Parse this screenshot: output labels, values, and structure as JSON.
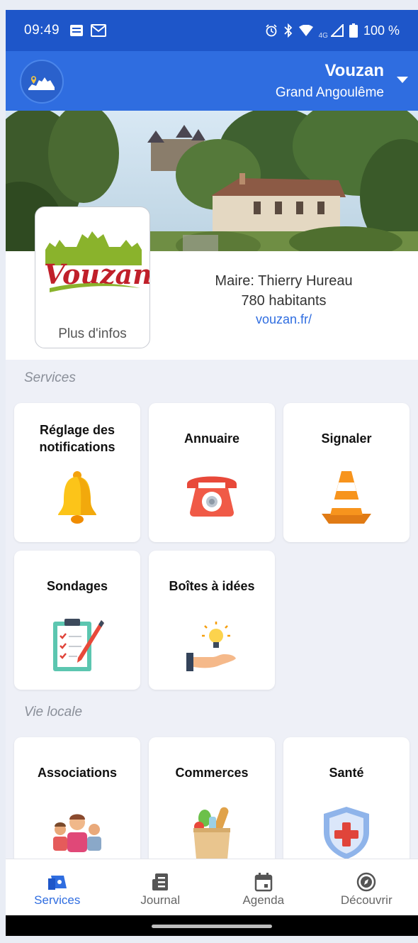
{
  "status_bar": {
    "time": "09:49",
    "network": "4G",
    "battery": "100 %"
  },
  "header": {
    "town": "Vouzan",
    "region": "Grand Angoulême"
  },
  "town_card": {
    "logo_text": "Vouzan",
    "more_label": "Plus d'infos"
  },
  "town_info": {
    "mayor": "Maire: Thierry Hureau",
    "population": "780 habitants",
    "website": "vouzan.fr/"
  },
  "sections": {
    "services": {
      "title": "Services",
      "items": [
        {
          "label": "Réglage des notifications",
          "icon": "bell-icon"
        },
        {
          "label": "Annuaire",
          "icon": "telephone-icon"
        },
        {
          "label": "Signaler",
          "icon": "traffic-cone-icon"
        },
        {
          "label": "Sondages",
          "icon": "clipboard-checklist-icon"
        },
        {
          "label": "Boîtes à idées",
          "icon": "lightbulb-hand-icon"
        }
      ]
    },
    "local_life": {
      "title": "Vie locale",
      "items": [
        {
          "label": "Associations",
          "icon": "people-group-icon"
        },
        {
          "label": "Commerces",
          "icon": "grocery-bag-icon"
        },
        {
          "label": "Santé",
          "icon": "medical-shield-icon"
        }
      ]
    }
  },
  "bottom_nav": [
    {
      "label": "Services",
      "icon": "services-icon",
      "active": true
    },
    {
      "label": "Journal",
      "icon": "newspaper-icon",
      "active": false
    },
    {
      "label": "Agenda",
      "icon": "calendar-icon",
      "active": false
    },
    {
      "label": "Découvrir",
      "icon": "compass-icon",
      "active": false
    }
  ],
  "colors": {
    "primary": "#2f6de0",
    "status_bar": "#1e56c9",
    "background": "#eef0f7"
  }
}
